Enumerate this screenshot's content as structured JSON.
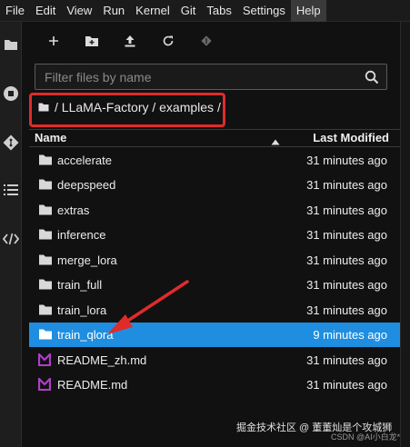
{
  "menubar": {
    "items": [
      "File",
      "Edit",
      "View",
      "Run",
      "Kernel",
      "Git",
      "Tabs",
      "Settings",
      "Help"
    ],
    "active": "Help"
  },
  "rail": {
    "icons": [
      "folder-icon",
      "stop-circle-icon",
      "git-icon",
      "list-icon",
      "code-icon"
    ]
  },
  "toolbar": {
    "icons": [
      "new-launcher-plus-icon",
      "new-folder-icon",
      "upload-icon",
      "refresh-icon",
      "git-clone-icon"
    ]
  },
  "filter": {
    "placeholder": "Filter files by name",
    "value": ""
  },
  "breadcrumb": {
    "path": "/ LLaMA-Factory / examples /"
  },
  "columns": {
    "name": "Name",
    "modified": "Last Modified"
  },
  "files": [
    {
      "name": "accelerate",
      "type": "folder",
      "modified": "31 minutes ago"
    },
    {
      "name": "deepspeed",
      "type": "folder",
      "modified": "31 minutes ago"
    },
    {
      "name": "extras",
      "type": "folder",
      "modified": "31 minutes ago"
    },
    {
      "name": "inference",
      "type": "folder",
      "modified": "31 minutes ago"
    },
    {
      "name": "merge_lora",
      "type": "folder",
      "modified": "31 minutes ago"
    },
    {
      "name": "train_full",
      "type": "folder",
      "modified": "31 minutes ago"
    },
    {
      "name": "train_lora",
      "type": "folder",
      "modified": "31 minutes ago"
    },
    {
      "name": "train_qlora",
      "type": "folder",
      "modified": "9 minutes ago",
      "selected": true
    },
    {
      "name": "README_zh.md",
      "type": "markdown",
      "modified": "31 minutes ago"
    },
    {
      "name": "README.md",
      "type": "markdown",
      "modified": "31 minutes ago"
    }
  ],
  "colors": {
    "selected_row": "#1f8ee0",
    "annotation_red": "#e02b2b",
    "markdown_icon": "#b03ec9"
  },
  "watermark": {
    "line1": "掘金技术社区 @ 董董灿是个攻城狮",
    "line2": "CSDN @AI小白龙*"
  }
}
